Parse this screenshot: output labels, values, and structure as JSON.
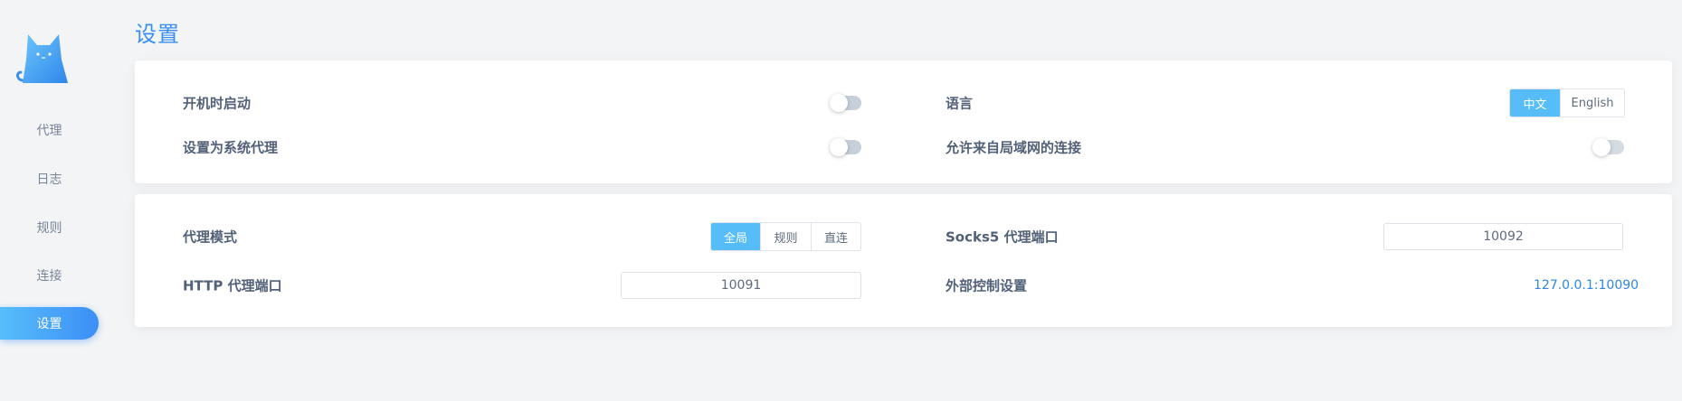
{
  "app": {
    "title": "设置"
  },
  "sidebar": {
    "items": [
      {
        "label": "代理"
      },
      {
        "label": "日志"
      },
      {
        "label": "规则"
      },
      {
        "label": "连接"
      },
      {
        "label": "设置"
      }
    ]
  },
  "general": {
    "start_at_login": {
      "label": "开机时启动",
      "enabled": false
    },
    "system_proxy": {
      "label": "设置为系统代理",
      "enabled": false
    },
    "language": {
      "label": "语言",
      "options": [
        "中文",
        "English"
      ],
      "selected": "中文"
    },
    "allow_lan": {
      "label": "允许来自局域网的连接",
      "enabled": false
    }
  },
  "proxy": {
    "mode": {
      "label": "代理模式",
      "options": [
        "全局",
        "规则",
        "直连"
      ],
      "selected": "全局"
    },
    "socks5_port": {
      "label": "Socks5 代理端口",
      "value": "10092"
    },
    "http_port": {
      "label": "HTTP 代理端口",
      "value": "10091"
    },
    "external_controller": {
      "label": "外部控制设置",
      "value": "127.0.0.1:10090"
    }
  },
  "colors": {
    "accent": "#3a8ef0",
    "selected": "#56bdf9",
    "toggle_off": "#c7d0da"
  },
  "icons": {
    "logo": "cat-logo-icon"
  }
}
